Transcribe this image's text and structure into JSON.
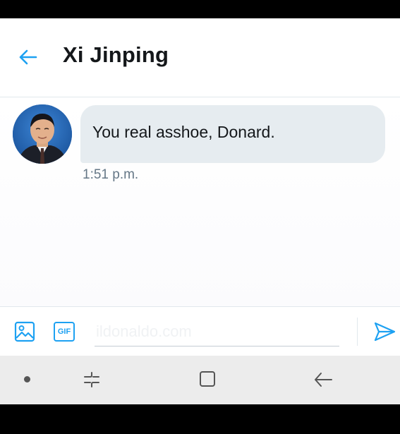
{
  "header": {
    "back_icon": "arrow-left-icon",
    "title": "Xi Jinping"
  },
  "conversation": {
    "messages": [
      {
        "sender_avatar": "avatar",
        "text": "You real asshoe, Donard.",
        "time": "1:51 p.m."
      }
    ]
  },
  "composer": {
    "image_icon": "image-icon",
    "gif_label": "GIF",
    "input_placeholder": "ildonaldo.com",
    "input_value": "",
    "send_icon": "send-icon"
  },
  "navbar": {
    "items": [
      "dot-icon",
      "recent-apps-icon",
      "home-icon",
      "back-icon"
    ]
  },
  "colors": {
    "accent": "#1da1f2",
    "bubble_bg": "#e6ecf0",
    "title_text": "#14171a",
    "muted_text": "#657786",
    "navbar_bg": "#ececec"
  }
}
